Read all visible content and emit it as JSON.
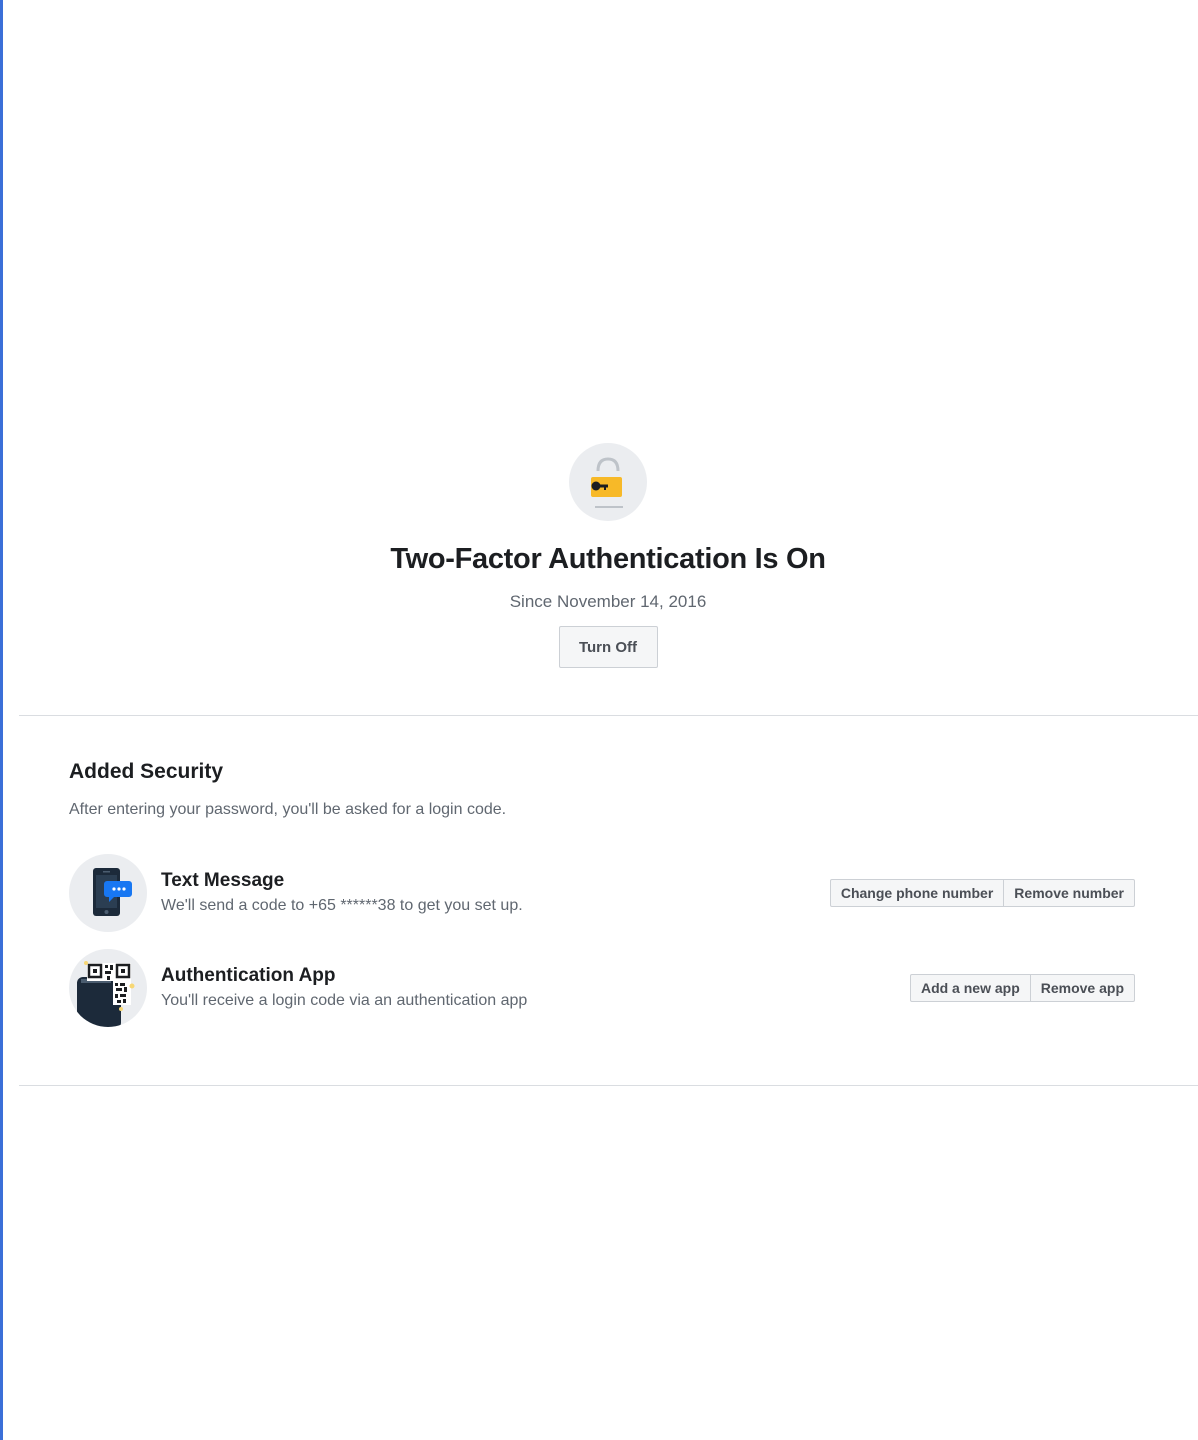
{
  "status": {
    "icon": "lock-key-icon",
    "title": "Two-Factor Authentication Is On",
    "since": "Since November 14, 2016",
    "turn_off_label": "Turn Off"
  },
  "added_security": {
    "title": "Added Security",
    "description": "After entering your password, you'll be asked for a login code.",
    "methods": [
      {
        "icon": "phone-message-icon",
        "title": "Text Message",
        "description": "We'll send a code to +65 ******38 to get you set up.",
        "actions": [
          "Change phone number",
          "Remove number"
        ]
      },
      {
        "icon": "qr-code-app-icon",
        "title": "Authentication App",
        "description": "You'll receive a login code via an authentication app",
        "actions": [
          "Add a new app",
          "Remove app"
        ]
      }
    ]
  },
  "colors": {
    "accent_edge": "#3b6fd8",
    "lock_yellow": "#f7b928",
    "message_blue": "#1877f2",
    "button_bg": "#f5f6f7",
    "button_border": "#ccd0d5"
  }
}
